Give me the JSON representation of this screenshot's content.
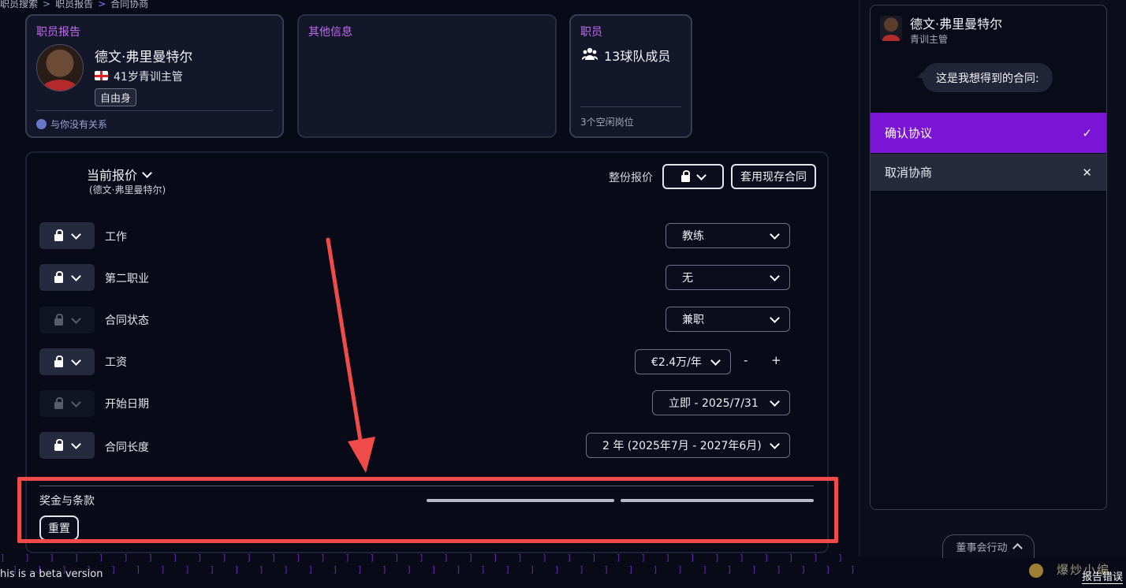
{
  "breadcrumb": [
    "职员搜索",
    "职员报告",
    "合同协商"
  ],
  "staff_card": {
    "title": "职员报告",
    "name": "德文·弗里曼特尔",
    "age_role": "41岁青训主管",
    "status_badge": "自由身",
    "relation": "与你没有关系"
  },
  "other_card": {
    "title": "其他信息"
  },
  "staff_count_card": {
    "title": "职员",
    "team_members": "13球队成员",
    "vacancies": "3个空闲岗位"
  },
  "offer": {
    "title": "当前报价",
    "subtitle": "(德文·弗里曼特尔)",
    "whole_offer_label": "整份报价",
    "apply_contract_button": "套用现存合同",
    "rows": [
      {
        "label": "工作",
        "value": "教练",
        "locked": true
      },
      {
        "label": "第二职业",
        "value": "无",
        "locked": true
      },
      {
        "label": "合同状态",
        "value": "兼职",
        "locked": false
      },
      {
        "label": "工资",
        "value": "€2.4万/年",
        "locked": true,
        "minus": "-",
        "plus": "+"
      },
      {
        "label": "开始日期",
        "value": "立即 - 2025/7/31",
        "locked": false
      },
      {
        "label": "合同长度",
        "value": "2 年 (2025年7月 - 2027年6月)",
        "locked": true
      }
    ],
    "bonus_label": "奖金与条款",
    "reset_button": "重置"
  },
  "chat": {
    "name": "德文·弗里曼特尔",
    "role": "青训主管",
    "message": "这是我想得到的合同:",
    "confirm": "确认协议",
    "confirm_icon": "✓",
    "cancel": "取消协商",
    "cancel_icon": "✕"
  },
  "board_actions": "董事会行动",
  "footer": {
    "beta": "his is a beta version",
    "report_error": "报告错误",
    "watermark": "爆炒小编"
  },
  "colors": {
    "accent_purple": "#7a15d6",
    "title_purple": "#c26cf2",
    "annotation_red": "#ef4b4b",
    "background": "#080a17"
  }
}
